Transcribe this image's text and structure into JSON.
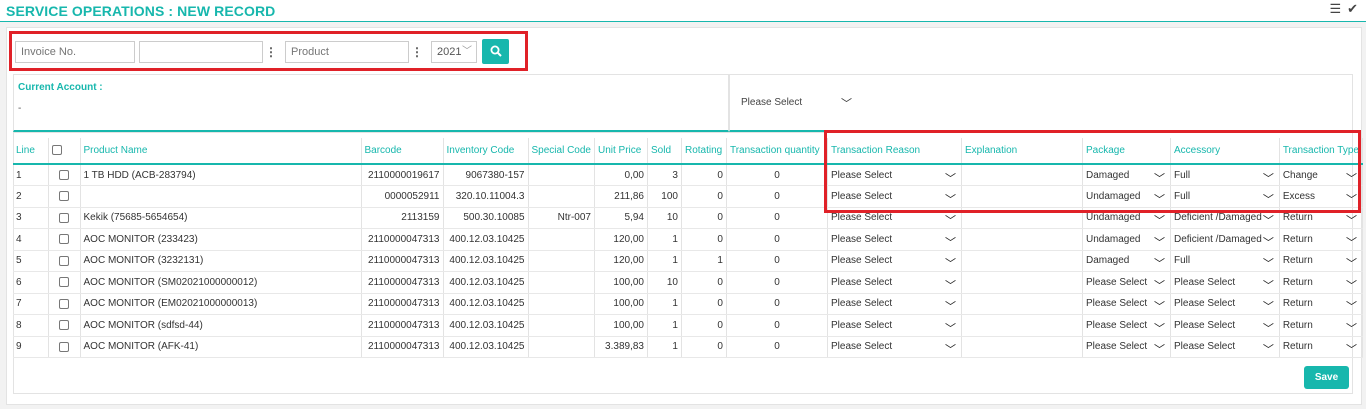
{
  "page": {
    "title": "SERVICE OPERATIONS : NEW RECORD"
  },
  "top_icons": [
    "list-icon",
    "check-icon"
  ],
  "filters": {
    "invoice_placeholder": "Invoice No.",
    "customer_value": "",
    "product_placeholder": "Product",
    "year_value": "2021"
  },
  "account": {
    "label": "Current Account :",
    "value": "-",
    "select_value": "Please Select"
  },
  "table": {
    "columns": [
      "Line",
      "",
      "Product Name",
      "Barcode",
      "Inventory Code",
      "Special Code",
      "Unit Price",
      "Sold",
      "Rotating",
      "Transaction quantity",
      "Transaction Reason",
      "Explanation",
      "Package",
      "Accessory",
      "Transaction Type"
    ],
    "rows": [
      {
        "line": "1",
        "product": "1 TB HDD (ACB-283794)",
        "barcode": "2110000019617",
        "inventory": "9067380-157",
        "special": "",
        "price": "0,00",
        "sold": "3",
        "rotating": "0",
        "qty": "0",
        "reason": "Please Select",
        "explanation": "",
        "package": "Damaged",
        "accessory": "Full",
        "type": "Change"
      },
      {
        "line": "2",
        "product": "",
        "barcode": "0000052911",
        "inventory": "320.10.11004.3",
        "special": "",
        "price": "211,86",
        "sold": "100",
        "rotating": "0",
        "qty": "0",
        "reason": "Please Select",
        "explanation": "",
        "package": "Undamaged",
        "accessory": "Full",
        "type": "Excess"
      },
      {
        "line": "3",
        "product": "Kekik (75685-5654654)",
        "barcode": "2113159",
        "inventory": "500.30.10085",
        "special": "Ntr-007",
        "price": "5,94",
        "sold": "10",
        "rotating": "0",
        "qty": "0",
        "reason": "Please Select",
        "explanation": "",
        "package": "Undamaged",
        "accessory": "Deficient /Damaged",
        "type": "Return"
      },
      {
        "line": "4",
        "product": "AOC MONITOR (233423)",
        "barcode": "2110000047313",
        "inventory": "400.12.03.10425",
        "special": "",
        "price": "120,00",
        "sold": "1",
        "rotating": "0",
        "qty": "0",
        "reason": "Please Select",
        "explanation": "",
        "package": "Undamaged",
        "accessory": "Deficient /Damaged",
        "type": "Return"
      },
      {
        "line": "5",
        "product": "AOC MONITOR (3232131)",
        "barcode": "2110000047313",
        "inventory": "400.12.03.10425",
        "special": "",
        "price": "120,00",
        "sold": "1",
        "rotating": "1",
        "qty": "0",
        "reason": "Please Select",
        "explanation": "",
        "package": "Damaged",
        "accessory": "Full",
        "type": "Return"
      },
      {
        "line": "6",
        "product": "AOC MONITOR (SM02021000000012)",
        "barcode": "2110000047313",
        "inventory": "400.12.03.10425",
        "special": "",
        "price": "100,00",
        "sold": "10",
        "rotating": "0",
        "qty": "0",
        "reason": "Please Select",
        "explanation": "",
        "package": "Please Select",
        "accessory": "Please Select",
        "type": "Return"
      },
      {
        "line": "7",
        "product": "AOC MONITOR (EM02021000000013)",
        "barcode": "2110000047313",
        "inventory": "400.12.03.10425",
        "special": "",
        "price": "100,00",
        "sold": "1",
        "rotating": "0",
        "qty": "0",
        "reason": "Please Select",
        "explanation": "",
        "package": "Please Select",
        "accessory": "Please Select",
        "type": "Return"
      },
      {
        "line": "8",
        "product": "AOC MONITOR (sdfsd-44)",
        "barcode": "2110000047313",
        "inventory": "400.12.03.10425",
        "special": "",
        "price": "100,00",
        "sold": "1",
        "rotating": "0",
        "qty": "0",
        "reason": "Please Select",
        "explanation": "",
        "package": "Please Select",
        "accessory": "Please Select",
        "type": "Return"
      },
      {
        "line": "9",
        "product": "AOC MONITOR (AFK-41)",
        "barcode": "2110000047313",
        "inventory": "400.12.03.10425",
        "special": "",
        "price": "3.389,83",
        "sold": "1",
        "rotating": "0",
        "qty": "0",
        "reason": "Please Select",
        "explanation": "",
        "package": "Please Select",
        "accessory": "Please Select",
        "type": "Return"
      }
    ]
  },
  "buttons": {
    "save": "Save"
  },
  "colors": {
    "accent": "#17b7ad",
    "highlight": "#e02128"
  }
}
